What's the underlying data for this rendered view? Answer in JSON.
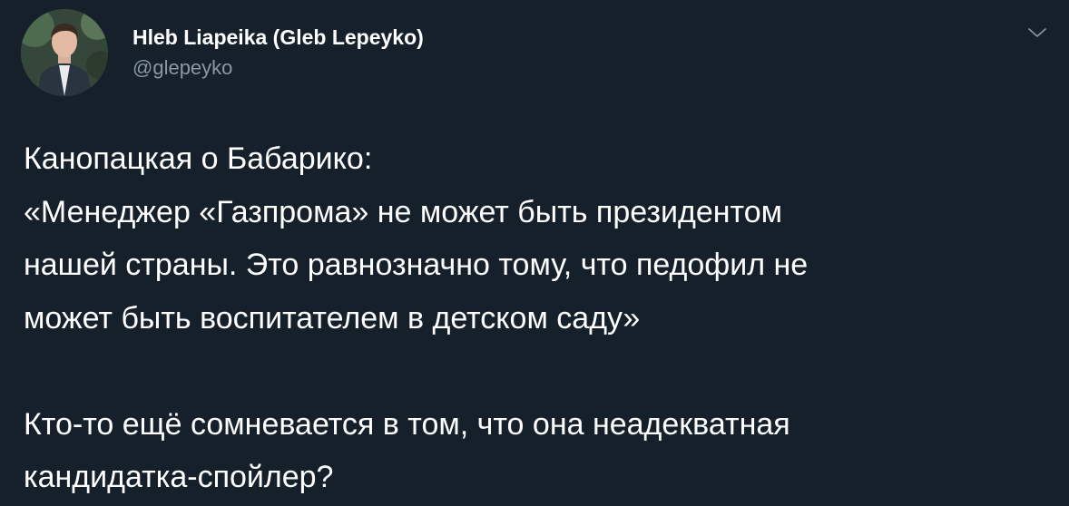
{
  "tweet": {
    "author": {
      "display_name": "Hleb Liapeika (Gleb Lepeyko)",
      "handle": "@glepeyko",
      "avatar_icon": "user-avatar-photo"
    },
    "menu_icon": "chevron-down-icon",
    "text_lines": [
      "Канопацкая о Бабарико:",
      "«Менеджер «Газпрома» не может быть президентом",
      "нашей страны. Это равнозначно тому, что педофил не",
      "может быть воспитателем в детском саду»",
      "Кто-то ещё сомневается в том, что она неадекватная",
      "кандидатка-спойлер?"
    ]
  },
  "colors": {
    "background": "#15202b",
    "primary_text": "#ffffff",
    "secondary_text": "#8899a6",
    "chevron": "#8899a6"
  }
}
